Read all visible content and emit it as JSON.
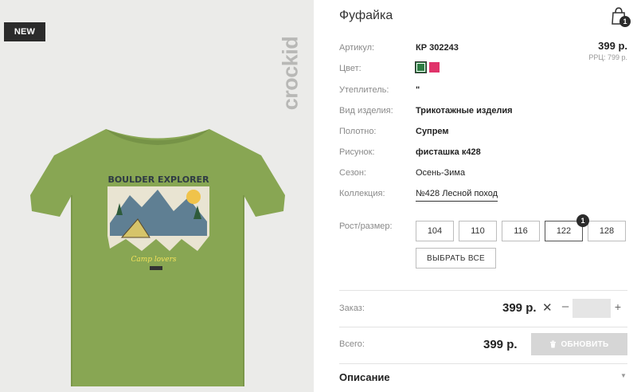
{
  "product": {
    "badge": "NEW",
    "brand": "crockid",
    "title": "Фуфайка"
  },
  "cart": {
    "count": "1"
  },
  "price": {
    "main": "399 р.",
    "rrp": "РРЦ: 799 р."
  },
  "attributes": [
    {
      "label": "Артикул:",
      "value": "КР 302243"
    },
    {
      "label": "Цвет:",
      "value": ""
    },
    {
      "label": "Утеплитель:",
      "value": "\""
    },
    {
      "label": "Вид изделия:",
      "value": "Трикотажные изделия"
    },
    {
      "label": "Полотно:",
      "value": "Супрем"
    },
    {
      "label": "Рисунок:",
      "value": "фисташка к428"
    },
    {
      "label": "Сезон:",
      "value": "Осень-Зима"
    },
    {
      "label": "Коллекция:",
      "value": "№428 Лесной поход"
    }
  ],
  "colors": [
    "#2e7d43",
    "#e0336a"
  ],
  "sizes": {
    "label": "Рост/размер:",
    "options": [
      "104",
      "110",
      "116",
      "122",
      "128"
    ],
    "selected": "122",
    "selected_count": "1",
    "select_all": "ВЫБРАТЬ ВСЕ"
  },
  "order": {
    "label": "Заказ:",
    "price": "399 р.",
    "times": "✕",
    "minus": "–",
    "plus": "+",
    "quantity": ""
  },
  "total": {
    "label": "Всего:",
    "price": "399 р.",
    "update": "ОБНОВИТЬ"
  },
  "description": {
    "label": "Описание"
  },
  "graphic": {
    "line1": "BOULDER EXPLORER",
    "line2": "Camp lovers"
  }
}
